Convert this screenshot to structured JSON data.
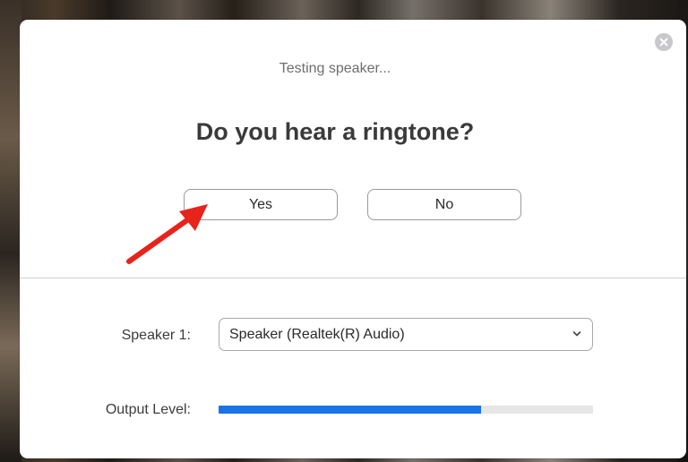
{
  "dialog": {
    "status_text": "Testing speaker...",
    "question": "Do you hear a ringtone?",
    "yes_label": "Yes",
    "no_label": "No",
    "close_icon": "close-icon"
  },
  "speaker": {
    "label": "Speaker 1:",
    "selected": "Speaker (Realtek(R) Audio)"
  },
  "output": {
    "label": "Output Level:",
    "level_fraction": 0.7
  },
  "colors": {
    "accent_blue": "#1a73e8",
    "arrow_red": "#e8231c"
  }
}
